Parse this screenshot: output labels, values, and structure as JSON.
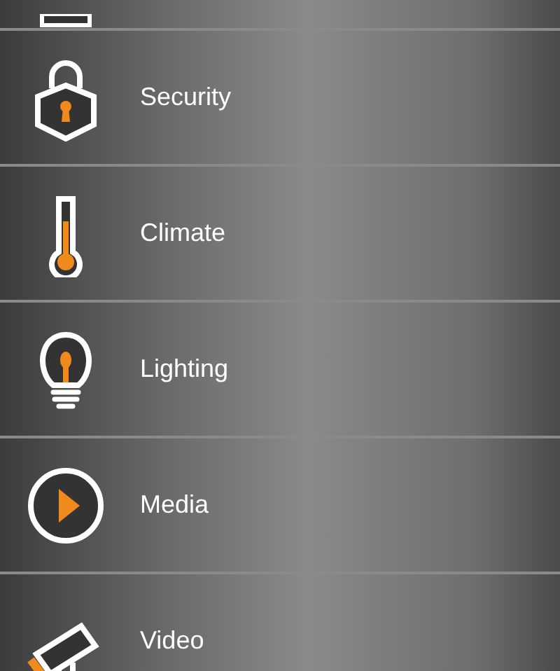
{
  "menu_items": [
    {
      "kind": "partial"
    },
    {
      "kind": "security",
      "label": "Security"
    },
    {
      "kind": "climate",
      "label": "Climate"
    },
    {
      "kind": "lighting",
      "label": "Lighting"
    },
    {
      "kind": "media",
      "label": "Media"
    },
    {
      "kind": "video",
      "label": "Video"
    }
  ]
}
